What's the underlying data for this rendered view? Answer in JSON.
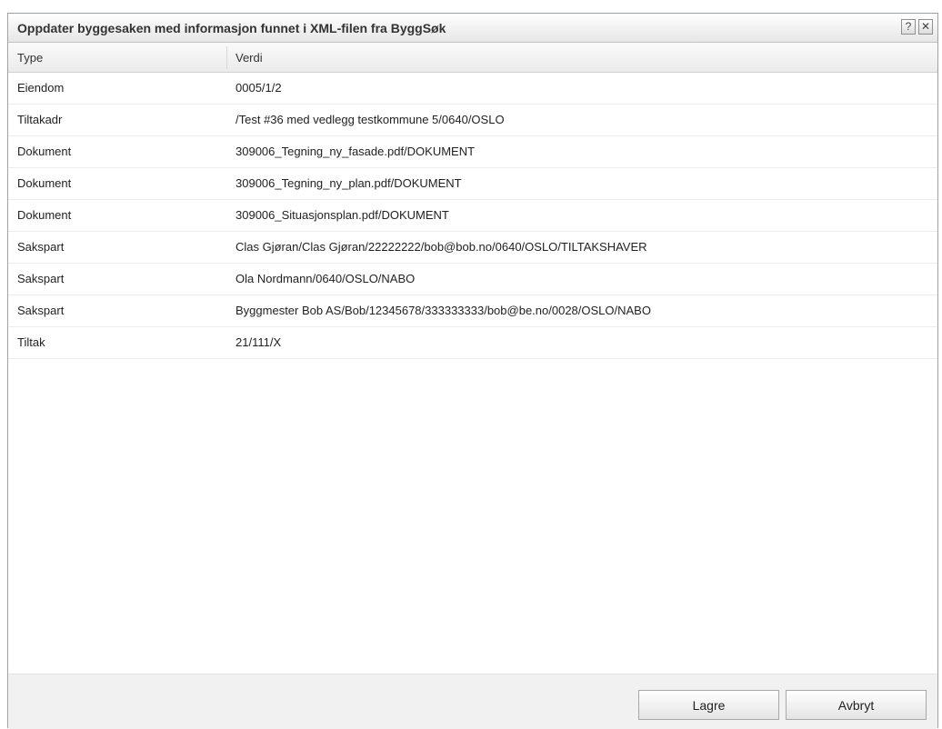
{
  "dialog": {
    "title": "Oppdater byggesaken med informasjon funnet i XML-filen fra ByggSøk",
    "help_label": "?",
    "close_label": "✕"
  },
  "grid": {
    "headers": [
      "Type",
      "Verdi"
    ],
    "rows": [
      {
        "type": "Eiendom",
        "verdi": "0005/1/2"
      },
      {
        "type": "Tiltakadr",
        "verdi": "/Test #36 med vedlegg testkommune 5/0640/OSLO"
      },
      {
        "type": "Dokument",
        "verdi": "309006_Tegning_ny_fasade.pdf/DOKUMENT"
      },
      {
        "type": "Dokument",
        "verdi": "309006_Tegning_ny_plan.pdf/DOKUMENT"
      },
      {
        "type": "Dokument",
        "verdi": "309006_Situasjonsplan.pdf/DOKUMENT"
      },
      {
        "type": "Sakspart",
        "verdi": "Clas Gjøran/Clas Gjøran/22222222/bob@bob.no/0640/OSLO/TILTAKSHAVER"
      },
      {
        "type": "Sakspart",
        "verdi": "Ola Nordmann/0640/OSLO/NABO"
      },
      {
        "type": "Sakspart",
        "verdi": "Byggmester Bob AS/Bob/12345678/333333333/bob@be.no/0028/OSLO/NABO"
      },
      {
        "type": "Tiltak",
        "verdi": "21/111/X"
      }
    ]
  },
  "footer": {
    "save_label": "Lagre",
    "cancel_label": "Avbryt"
  }
}
